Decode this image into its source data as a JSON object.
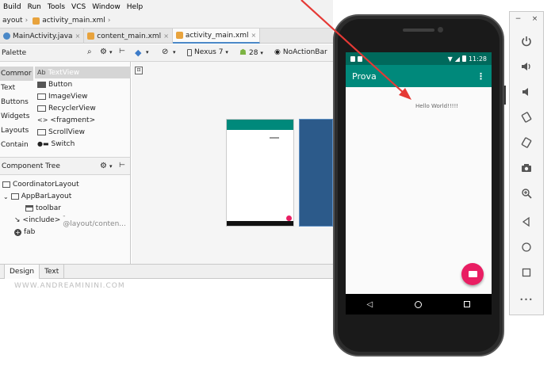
{
  "menu": [
    "Build",
    "Run",
    "Tools",
    "VCS",
    "Window",
    "Help"
  ],
  "breadcrumb": [
    "ayout",
    "activity_main.xml"
  ],
  "tabs": [
    {
      "label": "MainActivity.java",
      "icon_color": "#4a88c7"
    },
    {
      "label": "content_main.xml",
      "icon_color": "#e8a33d"
    },
    {
      "label": "activity_main.xml",
      "icon_color": "#e8a33d"
    }
  ],
  "toolbar": {
    "device": "Nexus 7",
    "api": "28",
    "theme": "NoActionBar"
  },
  "palette": {
    "title": "Palette",
    "categories": [
      "Commor",
      "Text",
      "Buttons",
      "Widgets",
      "Layouts",
      "Contain"
    ],
    "widgets": [
      "TextView",
      "Button",
      "ImageView",
      "RecyclerView",
      "<fragment>",
      "ScrollView",
      "Switch"
    ],
    "selected_prefix": "Ab"
  },
  "component_tree": {
    "title": "Component Tree",
    "nodes": [
      {
        "label": "CoordinatorLayout"
      },
      {
        "label": "AppBarLayout"
      },
      {
        "label": "toolbar"
      },
      {
        "label": "<include>",
        "extra": "- @layout/conten..."
      },
      {
        "label": "fab"
      }
    ]
  },
  "bottom_tabs": [
    "Design",
    "Text"
  ],
  "watermark": "WWW.ANDREAMININI.COM",
  "emulator": {
    "status_time": "11:28",
    "app_title": "Prova",
    "hello_text": "Hello World!!!!!"
  },
  "emu_panel": {
    "minimize": "−",
    "close": "×",
    "more": "•••"
  },
  "colors": {
    "app_bar": "#00897b",
    "status_bar": "#00695c",
    "fab": "#e91e63",
    "arrow": "#e53935",
    "blueprint": "#2c5a8a"
  }
}
